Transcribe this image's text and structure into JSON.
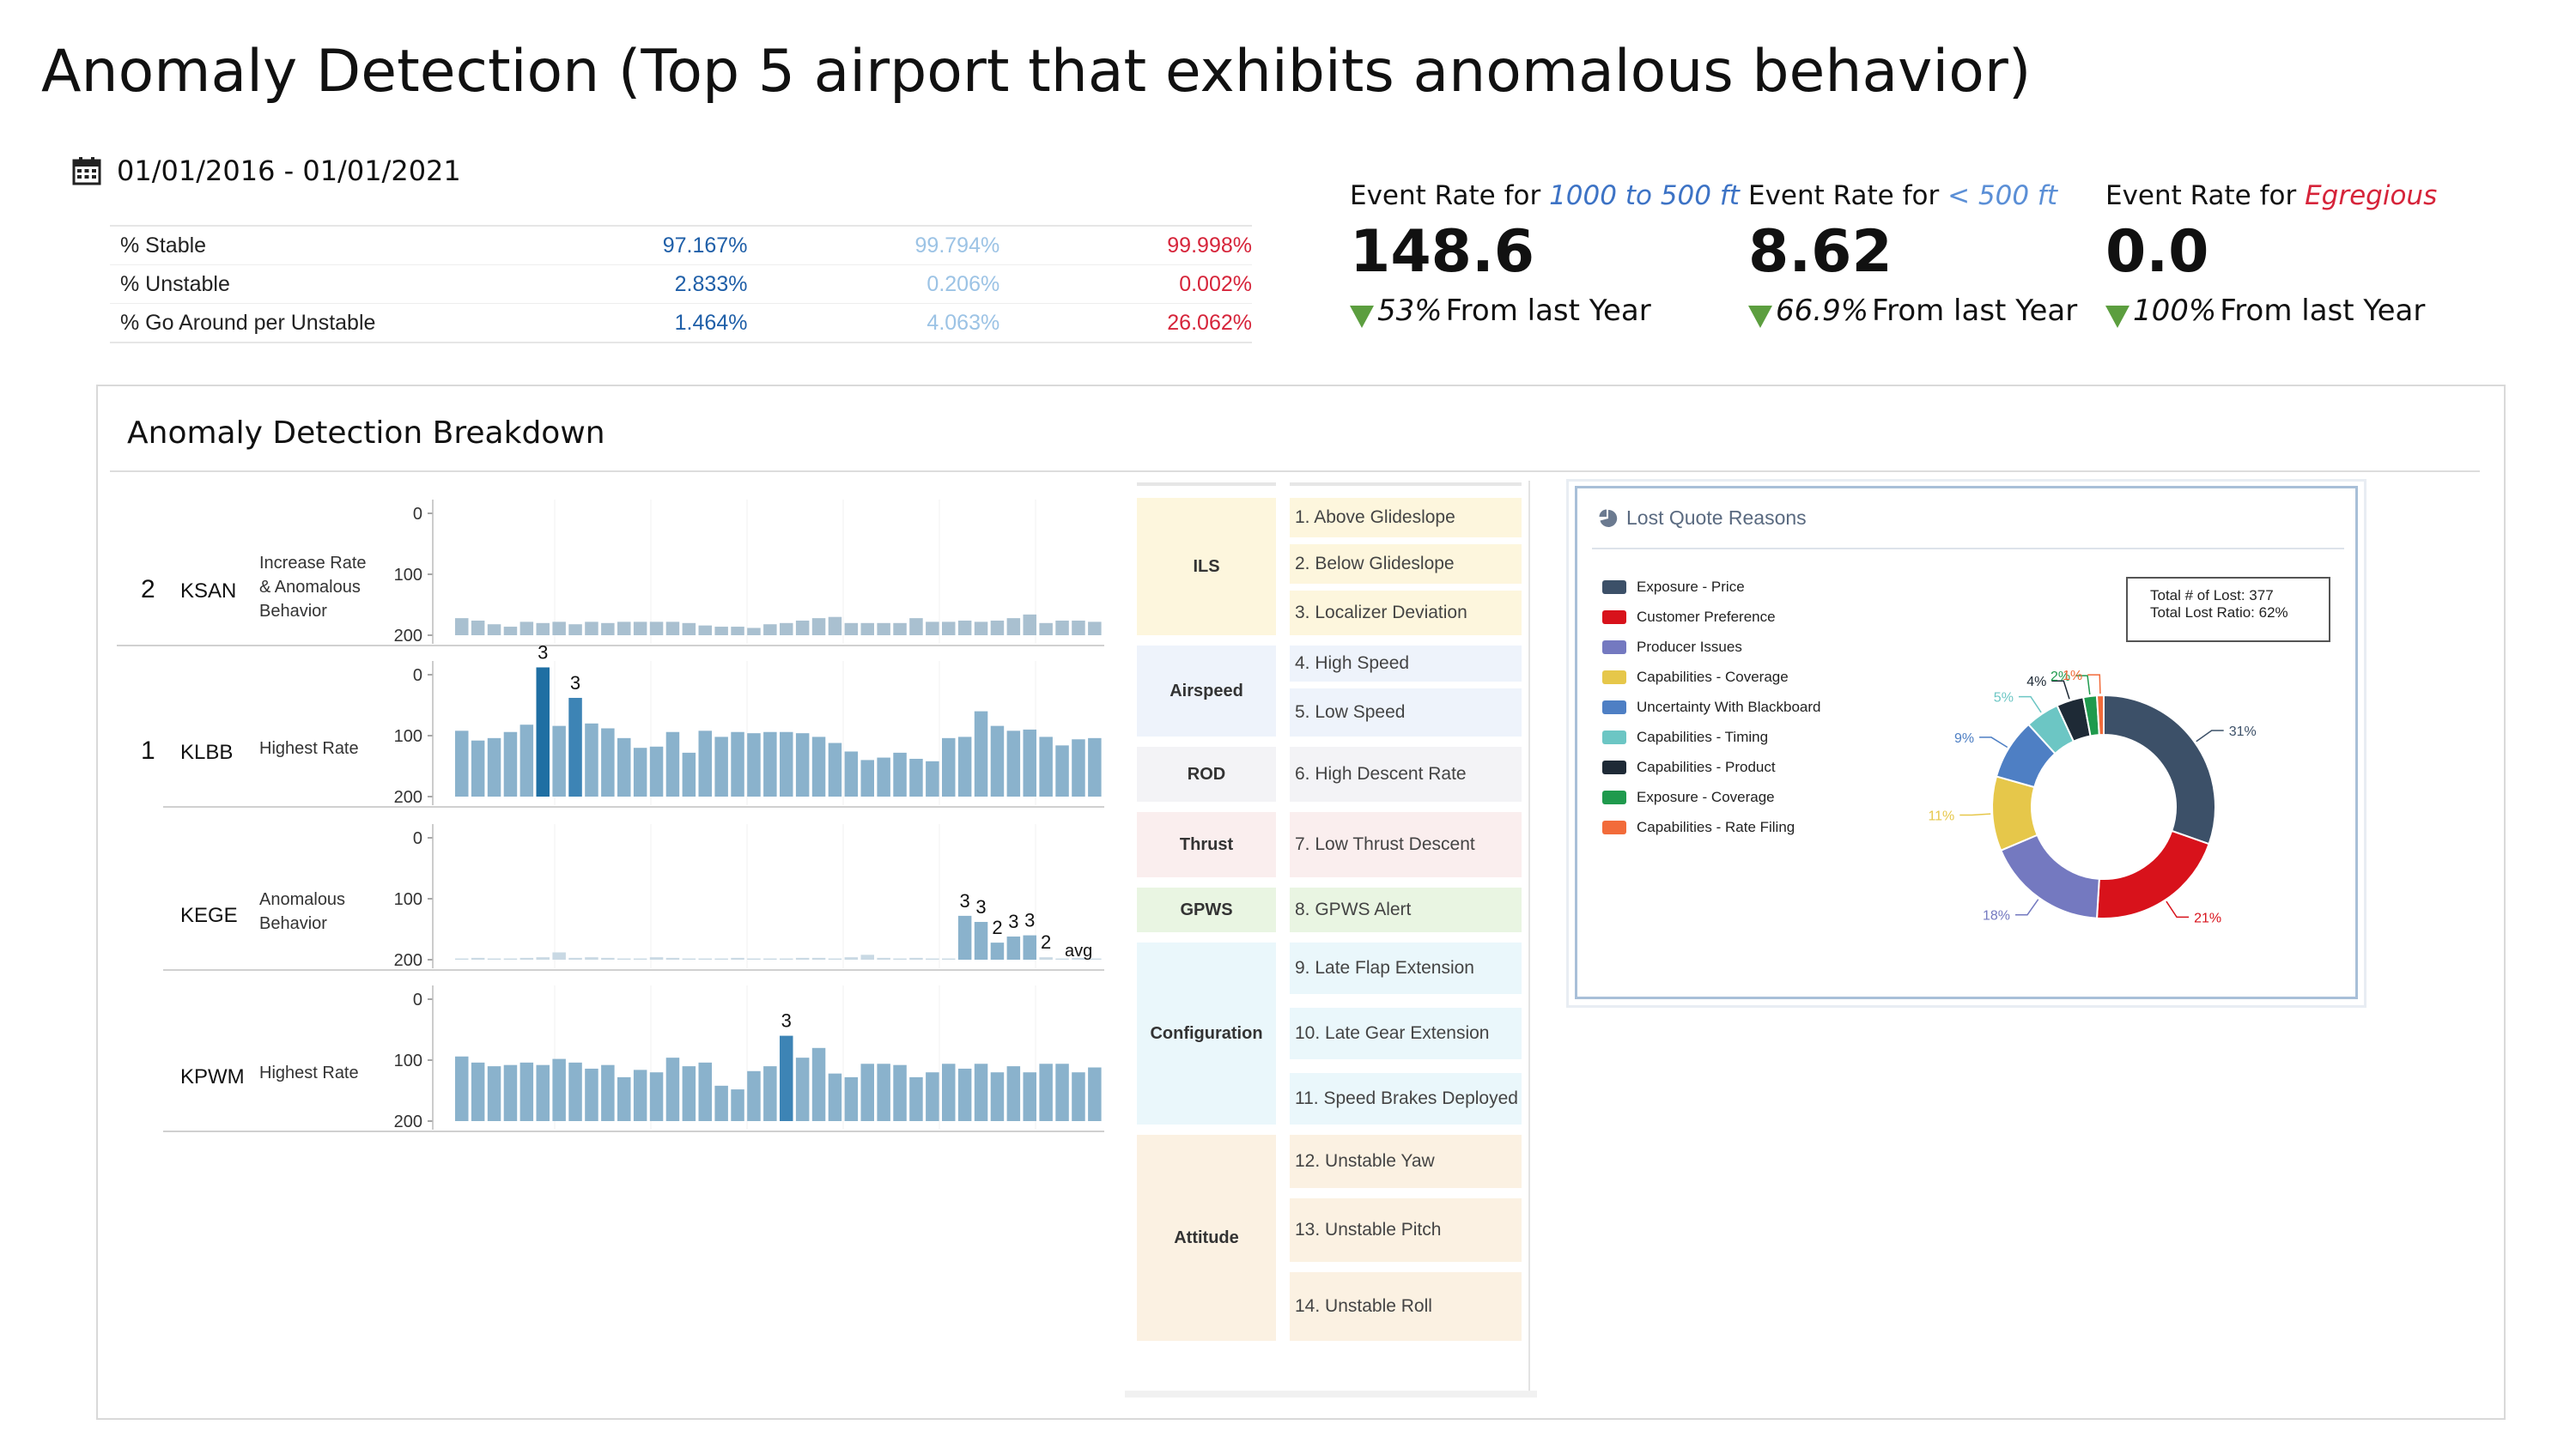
{
  "page": {
    "title": "Anomaly Detection (Top 5 airport that exhibits anomalous behavior)",
    "date_range": "01/01/2016 - 01/01/2021"
  },
  "stats": {
    "rows": [
      {
        "label": "% Stable",
        "v1": "97.167%",
        "v2": "99.794%",
        "v3": "99.998%"
      },
      {
        "label": "% Unstable",
        "v1": "2.833%",
        "v2": "0.206%",
        "v3": "0.002%"
      },
      {
        "label": "% Go Around per Unstable",
        "v1": "1.464%",
        "v2": "4.063%",
        "v3": "26.062%"
      }
    ]
  },
  "kpis": [
    {
      "label": "Event Rate for ",
      "qualifier": "1000 to 500 ft",
      "qualifier_color": "#3d73c5",
      "value": "148.6",
      "change": "53%",
      "change_suffix": " From last Year"
    },
    {
      "label": "Event Rate for ",
      "qualifier": "< 500 ft",
      "qualifier_color": "#5b8fd6",
      "value": "8.62",
      "change": "66.9%",
      "change_suffix": " From last Year"
    },
    {
      "label": "Event Rate for ",
      "qualifier": "Egregious",
      "qualifier_color": "#d6243a",
      "value": "0.0",
      "change": "100%",
      "change_suffix": " From last Year"
    }
  ],
  "breakdown": {
    "title": "Anomaly Detection Breakdown"
  },
  "chart_data": [
    {
      "type": "bar",
      "rank": "2",
      "airport": "KSAN",
      "reason": [
        "Increase Rate",
        "& Anomalous",
        "Behavior"
      ],
      "ylim": [
        0,
        200
      ],
      "yticks": [
        "200",
        "100",
        "0"
      ],
      "values": [
        28,
        24,
        18,
        14,
        22,
        20,
        22,
        18,
        22,
        20,
        22,
        22,
        22,
        22,
        20,
        16,
        14,
        14,
        12,
        18,
        20,
        24,
        28,
        30,
        20,
        20,
        20,
        20,
        28,
        22,
        22,
        24,
        22,
        24,
        28,
        34,
        20,
        24,
        24,
        22
      ],
      "highlight": [],
      "labels": []
    },
    {
      "type": "bar",
      "rank": "1",
      "airport": "KLBB",
      "reason": [
        "Highest Rate"
      ],
      "ylim": [
        0,
        200
      ],
      "yticks": [
        "200",
        "100",
        "0"
      ],
      "values": [
        108,
        92,
        96,
        106,
        118,
        212,
        116,
        162,
        120,
        112,
        96,
        80,
        82,
        106,
        72,
        108,
        98,
        106,
        104,
        106,
        106,
        104,
        98,
        88,
        74,
        60,
        64,
        72,
        62,
        58,
        96,
        98,
        140,
        116,
        108,
        110,
        98,
        84,
        94,
        96
      ],
      "highlight": [
        5,
        7
      ],
      "labels": [
        {
          "i": 5,
          "text": "3"
        },
        {
          "i": 7,
          "text": "3"
        }
      ]
    },
    {
      "type": "bar",
      "rank": "",
      "airport": "KEGE",
      "reason": [
        "Anomalous",
        "Behavior"
      ],
      "ylim": [
        0,
        200
      ],
      "yticks": [
        "200",
        "100",
        "0"
      ],
      "values": [
        2,
        3,
        2,
        2,
        3,
        4,
        12,
        3,
        4,
        3,
        2,
        2,
        4,
        3,
        2,
        2,
        2,
        3,
        2,
        2,
        2,
        3,
        3,
        2,
        4,
        8,
        3,
        2,
        3,
        2,
        2,
        72,
        62,
        28,
        38,
        40,
        4,
        2,
        3,
        2
      ],
      "highlight": [],
      "labels": [
        {
          "i": 31,
          "text": "3"
        },
        {
          "i": 32,
          "text": "3"
        },
        {
          "i": 33,
          "text": "2"
        },
        {
          "i": 34,
          "text": "3"
        },
        {
          "i": 35,
          "text": "3"
        },
        {
          "i": 36,
          "text": "2"
        }
      ],
      "end_label": "avg"
    },
    {
      "type": "bar",
      "rank": "",
      "airport": "KPWM",
      "reason": [
        "Highest Rate"
      ],
      "ylim": [
        0,
        200
      ],
      "yticks": [
        "200",
        "100",
        "0"
      ],
      "values": [
        106,
        96,
        90,
        92,
        96,
        92,
        102,
        96,
        86,
        92,
        72,
        84,
        80,
        104,
        90,
        96,
        58,
        52,
        82,
        90,
        140,
        104,
        120,
        78,
        72,
        94,
        94,
        92,
        72,
        80,
        94,
        86,
        94,
        80,
        90,
        80,
        94,
        94,
        80,
        88
      ],
      "highlight": [
        20
      ],
      "labels": [
        {
          "i": 20,
          "text": "3"
        }
      ]
    }
  ],
  "anomalies": {
    "categories": [
      {
        "name": "ILS",
        "items": [
          "1. Above Glideslope",
          "2. Below Glideslope",
          "3. Localizer Deviation"
        ]
      },
      {
        "name": "Airspeed",
        "items": [
          "4. High Speed",
          "5. Low Speed"
        ]
      },
      {
        "name": "ROD",
        "items": [
          "6. High Descent Rate"
        ]
      },
      {
        "name": "Thrust",
        "items": [
          "7. Low Thrust Descent"
        ]
      },
      {
        "name": "GPWS",
        "items": [
          "8. GPWS Alert"
        ]
      },
      {
        "name": "Configuration",
        "items": [
          "9. Late Flap Extension",
          "10. Late Gear Extension",
          "11. Speed Brakes Deployed"
        ]
      },
      {
        "name": "Attitude",
        "items": [
          "12. Unstable Yaw",
          "13. Unstable Pitch",
          "14. Unstable Roll"
        ]
      }
    ],
    "colors": {
      "ILS": "#fdf6dd",
      "Airspeed": "#eef3fb",
      "ROD": "#f3f3f6",
      "Thrust": "#faeeee",
      "GPWS": "#e9f5e2",
      "Configuration": "#eaf7fb",
      "Attitude": "#fbf1e2"
    }
  },
  "lost_quote": {
    "title": "Lost Quote Reasons",
    "total_lost": "Total # of Lost: 377",
    "total_ratio": "Total Lost Ratio: 62%",
    "legend": [
      {
        "name": "Exposure - Price",
        "color": "#3c5068"
      },
      {
        "name": "Customer Preference",
        "color": "#d8121b"
      },
      {
        "name": "Producer Issues",
        "color": "#7479c0"
      },
      {
        "name": "Capabilities - Coverage",
        "color": "#e6c74a"
      },
      {
        "name": "Uncertainty With Blackboard",
        "color": "#4e7fc4"
      },
      {
        "name": "Capabilities - Timing",
        "color": "#6cc6c4"
      },
      {
        "name": "Capabilities - Product",
        "color": "#1e2a36"
      },
      {
        "name": "Exposure - Coverage",
        "color": "#1f9a4d"
      },
      {
        "name": "Capabilities - Rate Filing",
        "color": "#f26b3a"
      }
    ],
    "chart_data": {
      "type": "pie",
      "slices": [
        {
          "name": "Exposure - Price",
          "value": 31,
          "label": "31%"
        },
        {
          "name": "Customer Preference",
          "value": 21,
          "label": "21%"
        },
        {
          "name": "Producer Issues",
          "value": 18,
          "label": "18%"
        },
        {
          "name": "Capabilities - Coverage",
          "value": 11,
          "label": "11%"
        },
        {
          "name": "Uncertainty With Blackboard",
          "value": 9,
          "label": "9%"
        },
        {
          "name": "Capabilities - Timing",
          "value": 5,
          "label": "5%"
        },
        {
          "name": "Capabilities - Product",
          "value": 4,
          "label": "4%"
        },
        {
          "name": "Exposure - Coverage",
          "value": 2,
          "label": "2%"
        },
        {
          "name": "Capabilities - Rate Filing",
          "value": 1,
          "label": "1%"
        }
      ]
    }
  }
}
